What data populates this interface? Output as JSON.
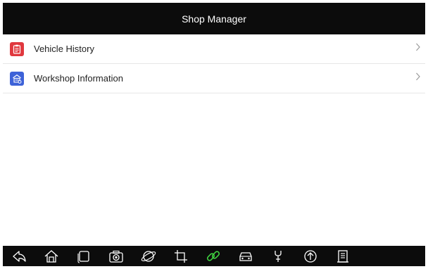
{
  "header": {
    "title": "Shop Manager"
  },
  "menu": {
    "items": [
      {
        "label": "Vehicle History",
        "icon": "clipboard-icon",
        "color": "#e0383e"
      },
      {
        "label": "Workshop Information",
        "icon": "garage-icon",
        "color": "#3d62d8"
      }
    ]
  },
  "navbar": {
    "buttons": [
      "back-icon",
      "home-icon",
      "recent-apps-icon",
      "camera-icon",
      "browser-icon",
      "crop-icon",
      "link-icon",
      "car-icon",
      "wrench-icon",
      "upload-icon",
      "report-icon"
    ],
    "active_color": "#3fd13f"
  },
  "colors": {
    "bar_background": "#0c0c0c",
    "icon_color": "#ffffff"
  }
}
